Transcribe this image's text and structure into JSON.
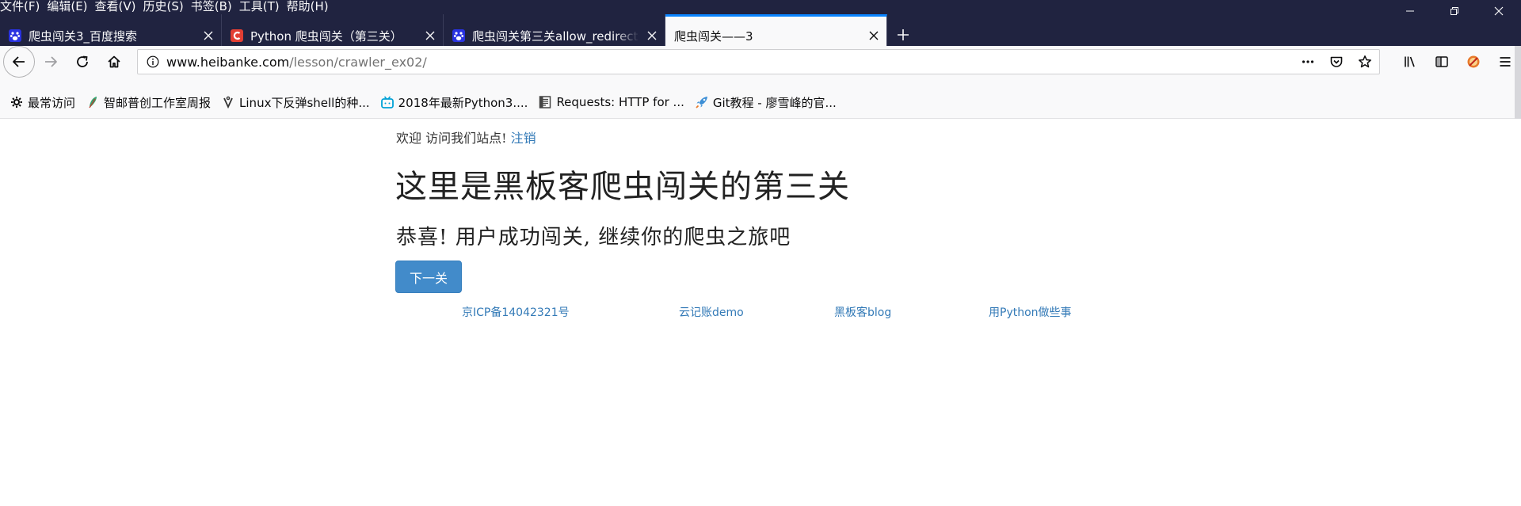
{
  "menubar": {
    "items": [
      "文件(F)",
      "编辑(E)",
      "查看(V)",
      "历史(S)",
      "书签(B)",
      "工具(T)",
      "帮助(H)"
    ]
  },
  "tabs": [
    {
      "title": "爬虫闯关3_百度搜索",
      "favicon": "baidu-icon",
      "selected": false
    },
    {
      "title": "Python 爬虫闯关（第三关）",
      "favicon": "csdn-icon",
      "selected": false
    },
    {
      "title": "爬虫闯关第三关allow_redirects",
      "favicon": "baidu-icon",
      "selected": false
    },
    {
      "title": "爬虫闯关——3",
      "favicon": "",
      "selected": true
    }
  ],
  "urlbar": {
    "host": "www.heibanke.com",
    "path": "/lesson/crawler_ex02/"
  },
  "bookmarks": [
    {
      "label": "最常访问",
      "icon": "gear-icon"
    },
    {
      "label": "智邮普创工作室周报",
      "icon": "feather-icon"
    },
    {
      "label": "Linux下反弹shell的种...",
      "icon": "anchor-icon"
    },
    {
      "label": "2018年最新Python3....",
      "icon": "bilibili-icon"
    },
    {
      "label": "Requests: HTTP for ...",
      "icon": "document-icon"
    },
    {
      "label": "Git教程 - 廖雪峰的官...",
      "icon": "rocket-icon"
    }
  ],
  "page": {
    "welcome_text": "欢迎 访问我们站点!",
    "logout_link": "注销",
    "heading": "这里是黑板客爬虫闯关的第三关",
    "subheading": "恭喜! 用户成功闯关, 继续你的爬虫之旅吧",
    "next_button": "下一关",
    "footer_links": [
      "京ICP备14042321号",
      "云记账demo",
      "黑板客blog",
      "用Python做些事"
    ]
  },
  "colors": {
    "chrome_bg": "#202340",
    "tab_accent": "#0a84ff",
    "link": "#337ab7",
    "button_bg": "#428bca"
  }
}
